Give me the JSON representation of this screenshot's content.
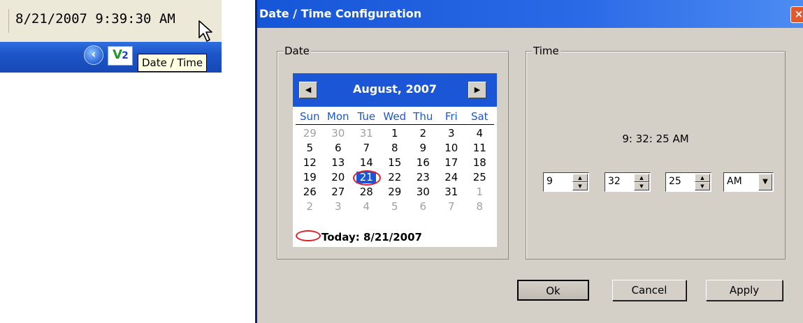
{
  "tray": {
    "clock_text": "8/21/2007 9:39:30 AM",
    "app_icon_text": "V",
    "app_icon_sub": "2",
    "tooltip": "Date / Time",
    "chevron": "‹"
  },
  "dialog": {
    "title": "Date / Time Configuration",
    "close_glyph": "×",
    "date_group_label": "Date",
    "time_group_label": "Time",
    "calendar": {
      "month_title": "August, 2007",
      "prev_glyph": "◀",
      "next_glyph": "▶",
      "weekdays": [
        "Sun",
        "Mon",
        "Tue",
        "Wed",
        "Thu",
        "Fri",
        "Sat"
      ],
      "weeks": [
        [
          {
            "d": "29",
            "other": true
          },
          {
            "d": "30",
            "other": true
          },
          {
            "d": "31",
            "other": true
          },
          {
            "d": "1"
          },
          {
            "d": "2"
          },
          {
            "d": "3"
          },
          {
            "d": "4"
          }
        ],
        [
          {
            "d": "5"
          },
          {
            "d": "6"
          },
          {
            "d": "7"
          },
          {
            "d": "8"
          },
          {
            "d": "9"
          },
          {
            "d": "10"
          },
          {
            "d": "11"
          }
        ],
        [
          {
            "d": "12"
          },
          {
            "d": "13"
          },
          {
            "d": "14"
          },
          {
            "d": "15"
          },
          {
            "d": "16"
          },
          {
            "d": "17"
          },
          {
            "d": "18"
          }
        ],
        [
          {
            "d": "19"
          },
          {
            "d": "20"
          },
          {
            "d": "21",
            "selected": true
          },
          {
            "d": "22"
          },
          {
            "d": "23"
          },
          {
            "d": "24"
          },
          {
            "d": "25"
          }
        ],
        [
          {
            "d": "26"
          },
          {
            "d": "27"
          },
          {
            "d": "28"
          },
          {
            "d": "29"
          },
          {
            "d": "30"
          },
          {
            "d": "31"
          },
          {
            "d": "1",
            "other": true
          }
        ],
        [
          {
            "d": "2",
            "other": true
          },
          {
            "d": "3",
            "other": true
          },
          {
            "d": "4",
            "other": true
          },
          {
            "d": "5",
            "other": true
          },
          {
            "d": "6",
            "other": true
          },
          {
            "d": "7",
            "other": true
          },
          {
            "d": "8",
            "other": true
          }
        ]
      ],
      "today_text": "Today: 8/21/2007",
      "accent_color": "#1a56d5",
      "highlight_color": "#e0202a"
    },
    "time": {
      "readout": "9: 32: 25 AM",
      "hour": "9",
      "minute": "32",
      "second": "25",
      "ampm": "AM",
      "spin_up": "▲",
      "spin_down": "▼",
      "dropdown_glyph": "▼"
    },
    "buttons": {
      "ok": "Ok",
      "cancel": "Cancel",
      "apply": "Apply"
    }
  }
}
